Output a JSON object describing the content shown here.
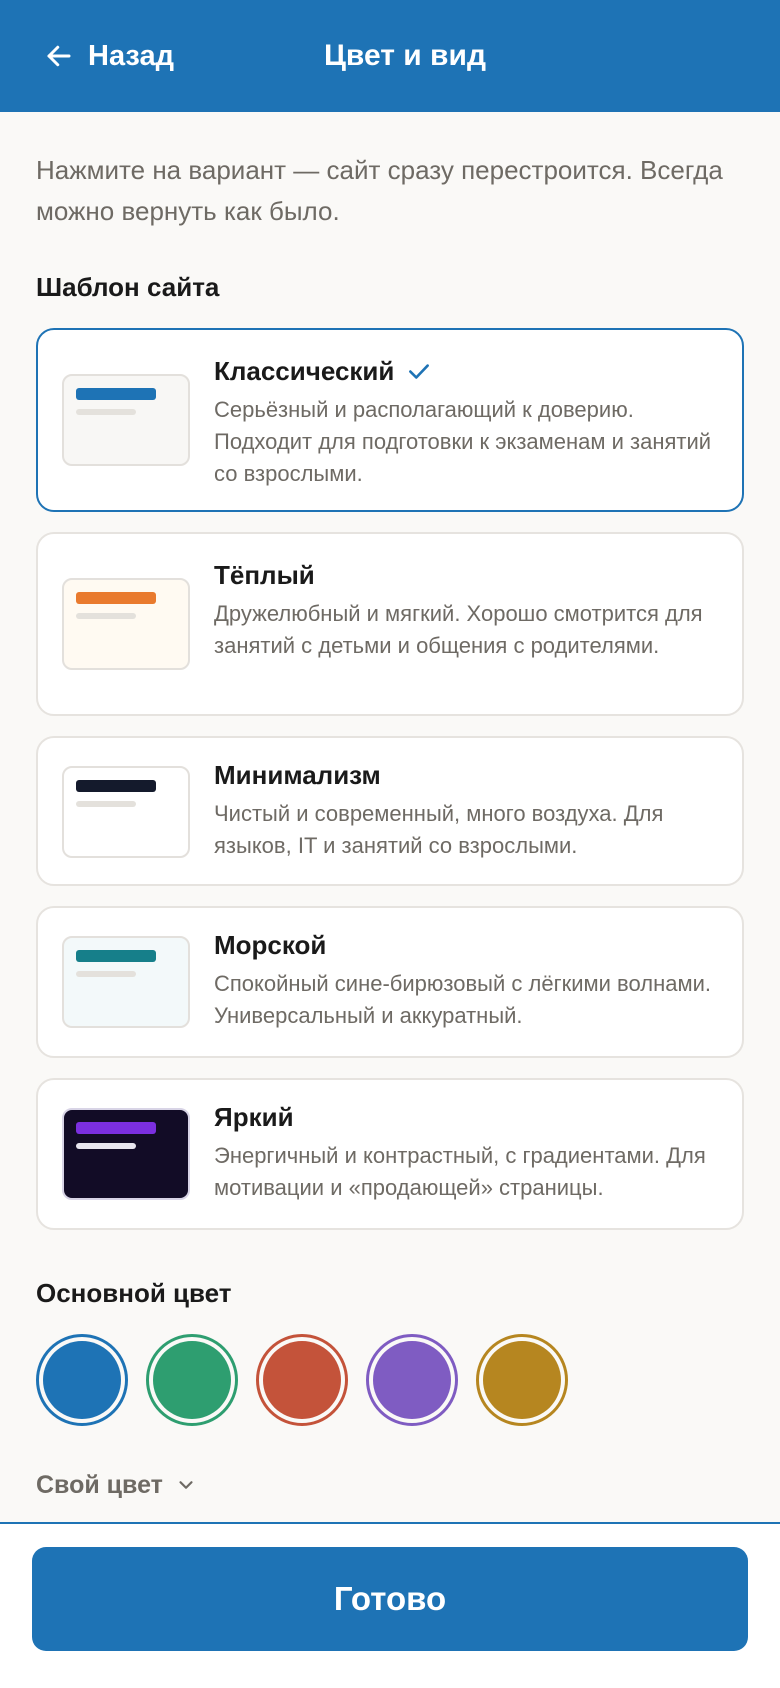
{
  "header": {
    "back_label": "Назад",
    "title": "Цвет и вид"
  },
  "intro": "Нажмите на вариант — сайт сразу перестроится. Всегда можно вернуть как было.",
  "templates_section": {
    "title": "Шаблон сайта",
    "items": [
      {
        "title": "Классический",
        "description": "Серьёзный и располагающий к доверию. Подходит для подготовки к экзаменам и занятий со взрослыми.",
        "selected": true,
        "accent": "#1e73b5",
        "thumb_bg": "#f8f7f5"
      },
      {
        "title": "Тёплый",
        "description": "Дружелюбный и мягкий. Хорошо смотрится для занятий с детьми и общения с родителями.",
        "selected": false,
        "accent": "#e97a2e",
        "thumb_bg": "#fffaf2"
      },
      {
        "title": "Минимализм",
        "description": "Чистый и современный, много воздуха. Для языков, IT и занятий со взрослыми.",
        "selected": false,
        "accent": "#141a2c",
        "thumb_bg": "#ffffff"
      },
      {
        "title": "Морской",
        "description": "Спокойный сине-бирюзовый с лёгкими волнами. Универсальный и аккуратный.",
        "selected": false,
        "accent": "#167f8a",
        "thumb_bg": "#f3f9fa"
      },
      {
        "title": "Яркий",
        "description": "Энергичный и контрастный, с градиентами. Для мотивации и «продающей» страницы.",
        "selected": false,
        "accent": "#7b2fe0",
        "thumb_bg": "#120c26"
      }
    ]
  },
  "color_section": {
    "title": "Основной цвет",
    "swatches": [
      "#1e73b5",
      "#2e9e70",
      "#c4533a",
      "#7f5cc2",
      "#b68620"
    ],
    "selected_index": 0,
    "custom_label": "Свой цвет"
  },
  "footer": {
    "done_label": "Готово"
  },
  "colors": {
    "brand": "#1e73b5",
    "muted_text": "#6e6a64"
  }
}
